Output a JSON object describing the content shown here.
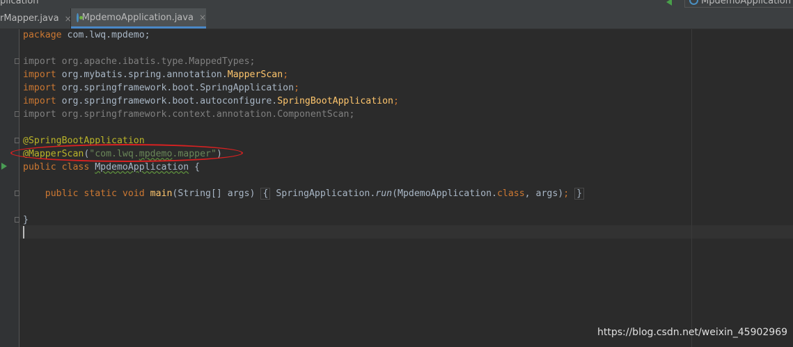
{
  "window": {
    "left_title_fragment": "plication",
    "right_title": "MpdemoApplication"
  },
  "tabs": [
    {
      "label": "rMapper.java",
      "close": "×",
      "active": false
    },
    {
      "label": "MpdemoApplication.java",
      "close": "×",
      "active": true
    }
  ],
  "code": {
    "package_kw": "package",
    "package_name": " com.lwq.mpdemo;",
    "imports": [
      {
        "kw": "import",
        "path": " org.apache.ibatis.type.",
        "cls": "MappedTypes",
        "end": ";",
        "unused": true
      },
      {
        "kw": "import",
        "path": " org.mybatis.spring.annotation.",
        "cls": "MapperScan",
        "end": ";",
        "unused": false
      },
      {
        "kw": "import",
        "path": " org.springframework.boot.",
        "cls": "SpringApplication",
        "end": ";",
        "unused": false
      },
      {
        "kw": "import",
        "path": " org.springframework.boot.autoconfigure.",
        "cls": "SpringBootApplication",
        "end": ";",
        "unused": false
      },
      {
        "kw": "import",
        "path": " org.springframework.context.annotation.",
        "cls": "ComponentScan",
        "end": ";",
        "unused": true
      }
    ],
    "annotation1": "@SpringBootApplication",
    "annotation2_name": "@MapperScan",
    "annotation2_open": "(",
    "annotation2_str_a": "\"com.lwq.",
    "annotation2_str_b": "mpdemo",
    "annotation2_str_c": ".mapper\"",
    "annotation2_close": ")",
    "class_mods": "public class",
    "class_name": "MpdemoApplication",
    "class_open": " {",
    "main_mods": "public static void",
    "main_name": "main",
    "main_params": "(String[] args) ",
    "main_body_open": "{",
    "main_body_call_a": " SpringApplication.",
    "main_body_call_b": "run",
    "main_body_call_c": "(MpdemoApplication.",
    "main_body_class_kw": "class",
    "main_body_call_d": ", args)",
    "main_body_semicolon": ";",
    "main_body_close": "}",
    "class_close": "}"
  },
  "watermark": "https://blog.csdn.net/weixin_45902969",
  "colors": {
    "editor_bg": "#2b2b2b",
    "keyword": "#cc7832",
    "annotation": "#bbb529",
    "string": "#6a8759",
    "method": "#ffc66d",
    "highlight_circle": "#d92121"
  }
}
